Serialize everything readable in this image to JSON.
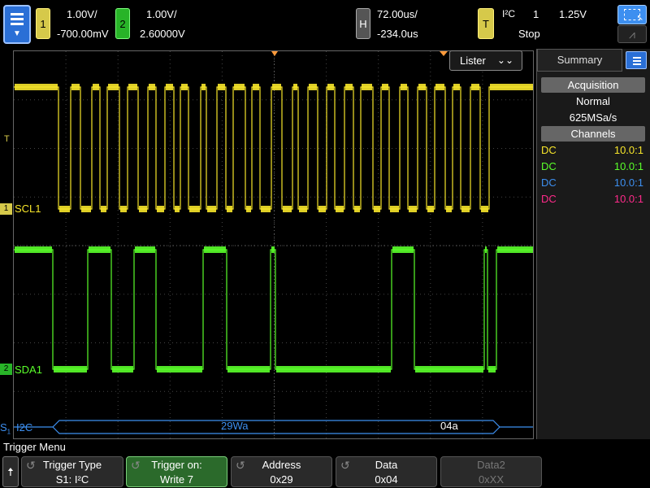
{
  "top": {
    "ch1": {
      "number": "1",
      "scale": "1.00V/",
      "offset": "-700.00mV"
    },
    "ch2": {
      "number": "2",
      "scale": "1.00V/",
      "offset": "2.60000V"
    },
    "horizontal": {
      "label": "H",
      "timebase": "72.00us/",
      "delay": "-234.0us"
    },
    "trigger": {
      "label": "T",
      "type": "I²C",
      "source": "1",
      "level": "1.25V",
      "status": "Stop"
    }
  },
  "scope": {
    "lister_label": "Lister",
    "ch1_label": "SCL1",
    "ch2_label": "SDA1",
    "serial_label": "I2C",
    "serial_marker": "S",
    "serial_marker_sub": "1",
    "trigger_marker": "T",
    "decode": [
      {
        "text": "29Wa"
      },
      {
        "text": "04a"
      }
    ]
  },
  "panel": {
    "tab": "Summary",
    "acquisition_head": "Acquisition",
    "mode": "Normal",
    "rate": "625MSa/s",
    "channels_head": "Channels",
    "channels": [
      {
        "coupling": "DC",
        "probe": "10.0:1",
        "color": "#f7e52a"
      },
      {
        "coupling": "DC",
        "probe": "10.0:1",
        "color": "#5aff2a"
      },
      {
        "coupling": "DC",
        "probe": "10.0:1",
        "color": "#3d8ff0"
      },
      {
        "coupling": "DC",
        "probe": "10.0:1",
        "color": "#ff2a8a"
      }
    ]
  },
  "menu": {
    "title": "Trigger Menu",
    "softkeys": [
      {
        "top": "Trigger Type",
        "bottom": "S1: I²C"
      },
      {
        "top": "Trigger on:",
        "bottom": "Write 7"
      },
      {
        "top": "Address",
        "bottom": "0x29"
      },
      {
        "top": "Data",
        "bottom": "0x04"
      },
      {
        "top": "Data2",
        "bottom": "0xXX"
      }
    ]
  },
  "colors": {
    "ch1": "#f7e52a",
    "ch2": "#5aff2a",
    "serial": "#3d8ff0"
  }
}
